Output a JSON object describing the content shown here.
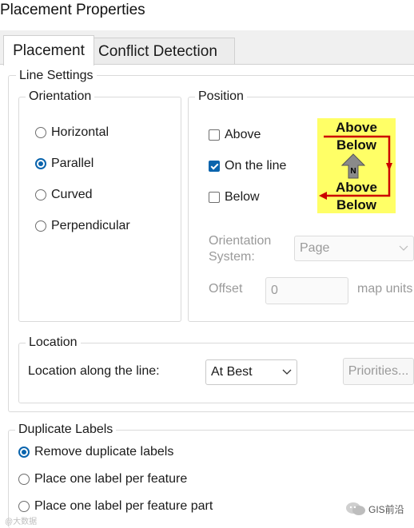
{
  "window": {
    "title": "Placement Properties"
  },
  "tabs": [
    {
      "label": "Placement",
      "active": true
    },
    {
      "label": "Conflict Detection",
      "active": false
    }
  ],
  "line_settings": {
    "legend": "Line Settings",
    "orientation": {
      "legend": "Orientation",
      "options": [
        {
          "label": "Horizontal",
          "selected": false
        },
        {
          "label": "Parallel",
          "selected": true
        },
        {
          "label": "Curved",
          "selected": false
        },
        {
          "label": "Perpendicular",
          "selected": false
        }
      ]
    },
    "position": {
      "legend": "Position",
      "checks": [
        {
          "label": "Above",
          "checked": false
        },
        {
          "label": "On the line",
          "checked": true
        },
        {
          "label": "Below",
          "checked": false
        }
      ],
      "preview": {
        "top_above": "Above",
        "top_below": "Below",
        "north_letter": "N",
        "bottom_above": "Above",
        "bottom_below": "Below",
        "bg_color": "#ffff66",
        "line_color": "#cc0000"
      },
      "orientation_system_label": "Orientation System:",
      "orientation_system_value": "Page",
      "offset_label": "Offset",
      "offset_value": "0",
      "offset_units": "map units"
    }
  },
  "location": {
    "legend": "Location",
    "along_line_label": "Location along the line:",
    "along_line_value": "At Best",
    "priorities_button": "Priorities..."
  },
  "duplicate_labels": {
    "legend": "Duplicate Labels",
    "options": [
      {
        "label": "Remove duplicate labels",
        "selected": true
      },
      {
        "label": "Place one label per feature",
        "selected": false
      },
      {
        "label": "Place one label per feature part",
        "selected": false
      }
    ]
  },
  "overlay": {
    "brand": "GIS前沿",
    "watermark": "@大数据"
  },
  "colors": {
    "accent": "#0a64ad",
    "dialog_bg": "#f0f0f0"
  }
}
